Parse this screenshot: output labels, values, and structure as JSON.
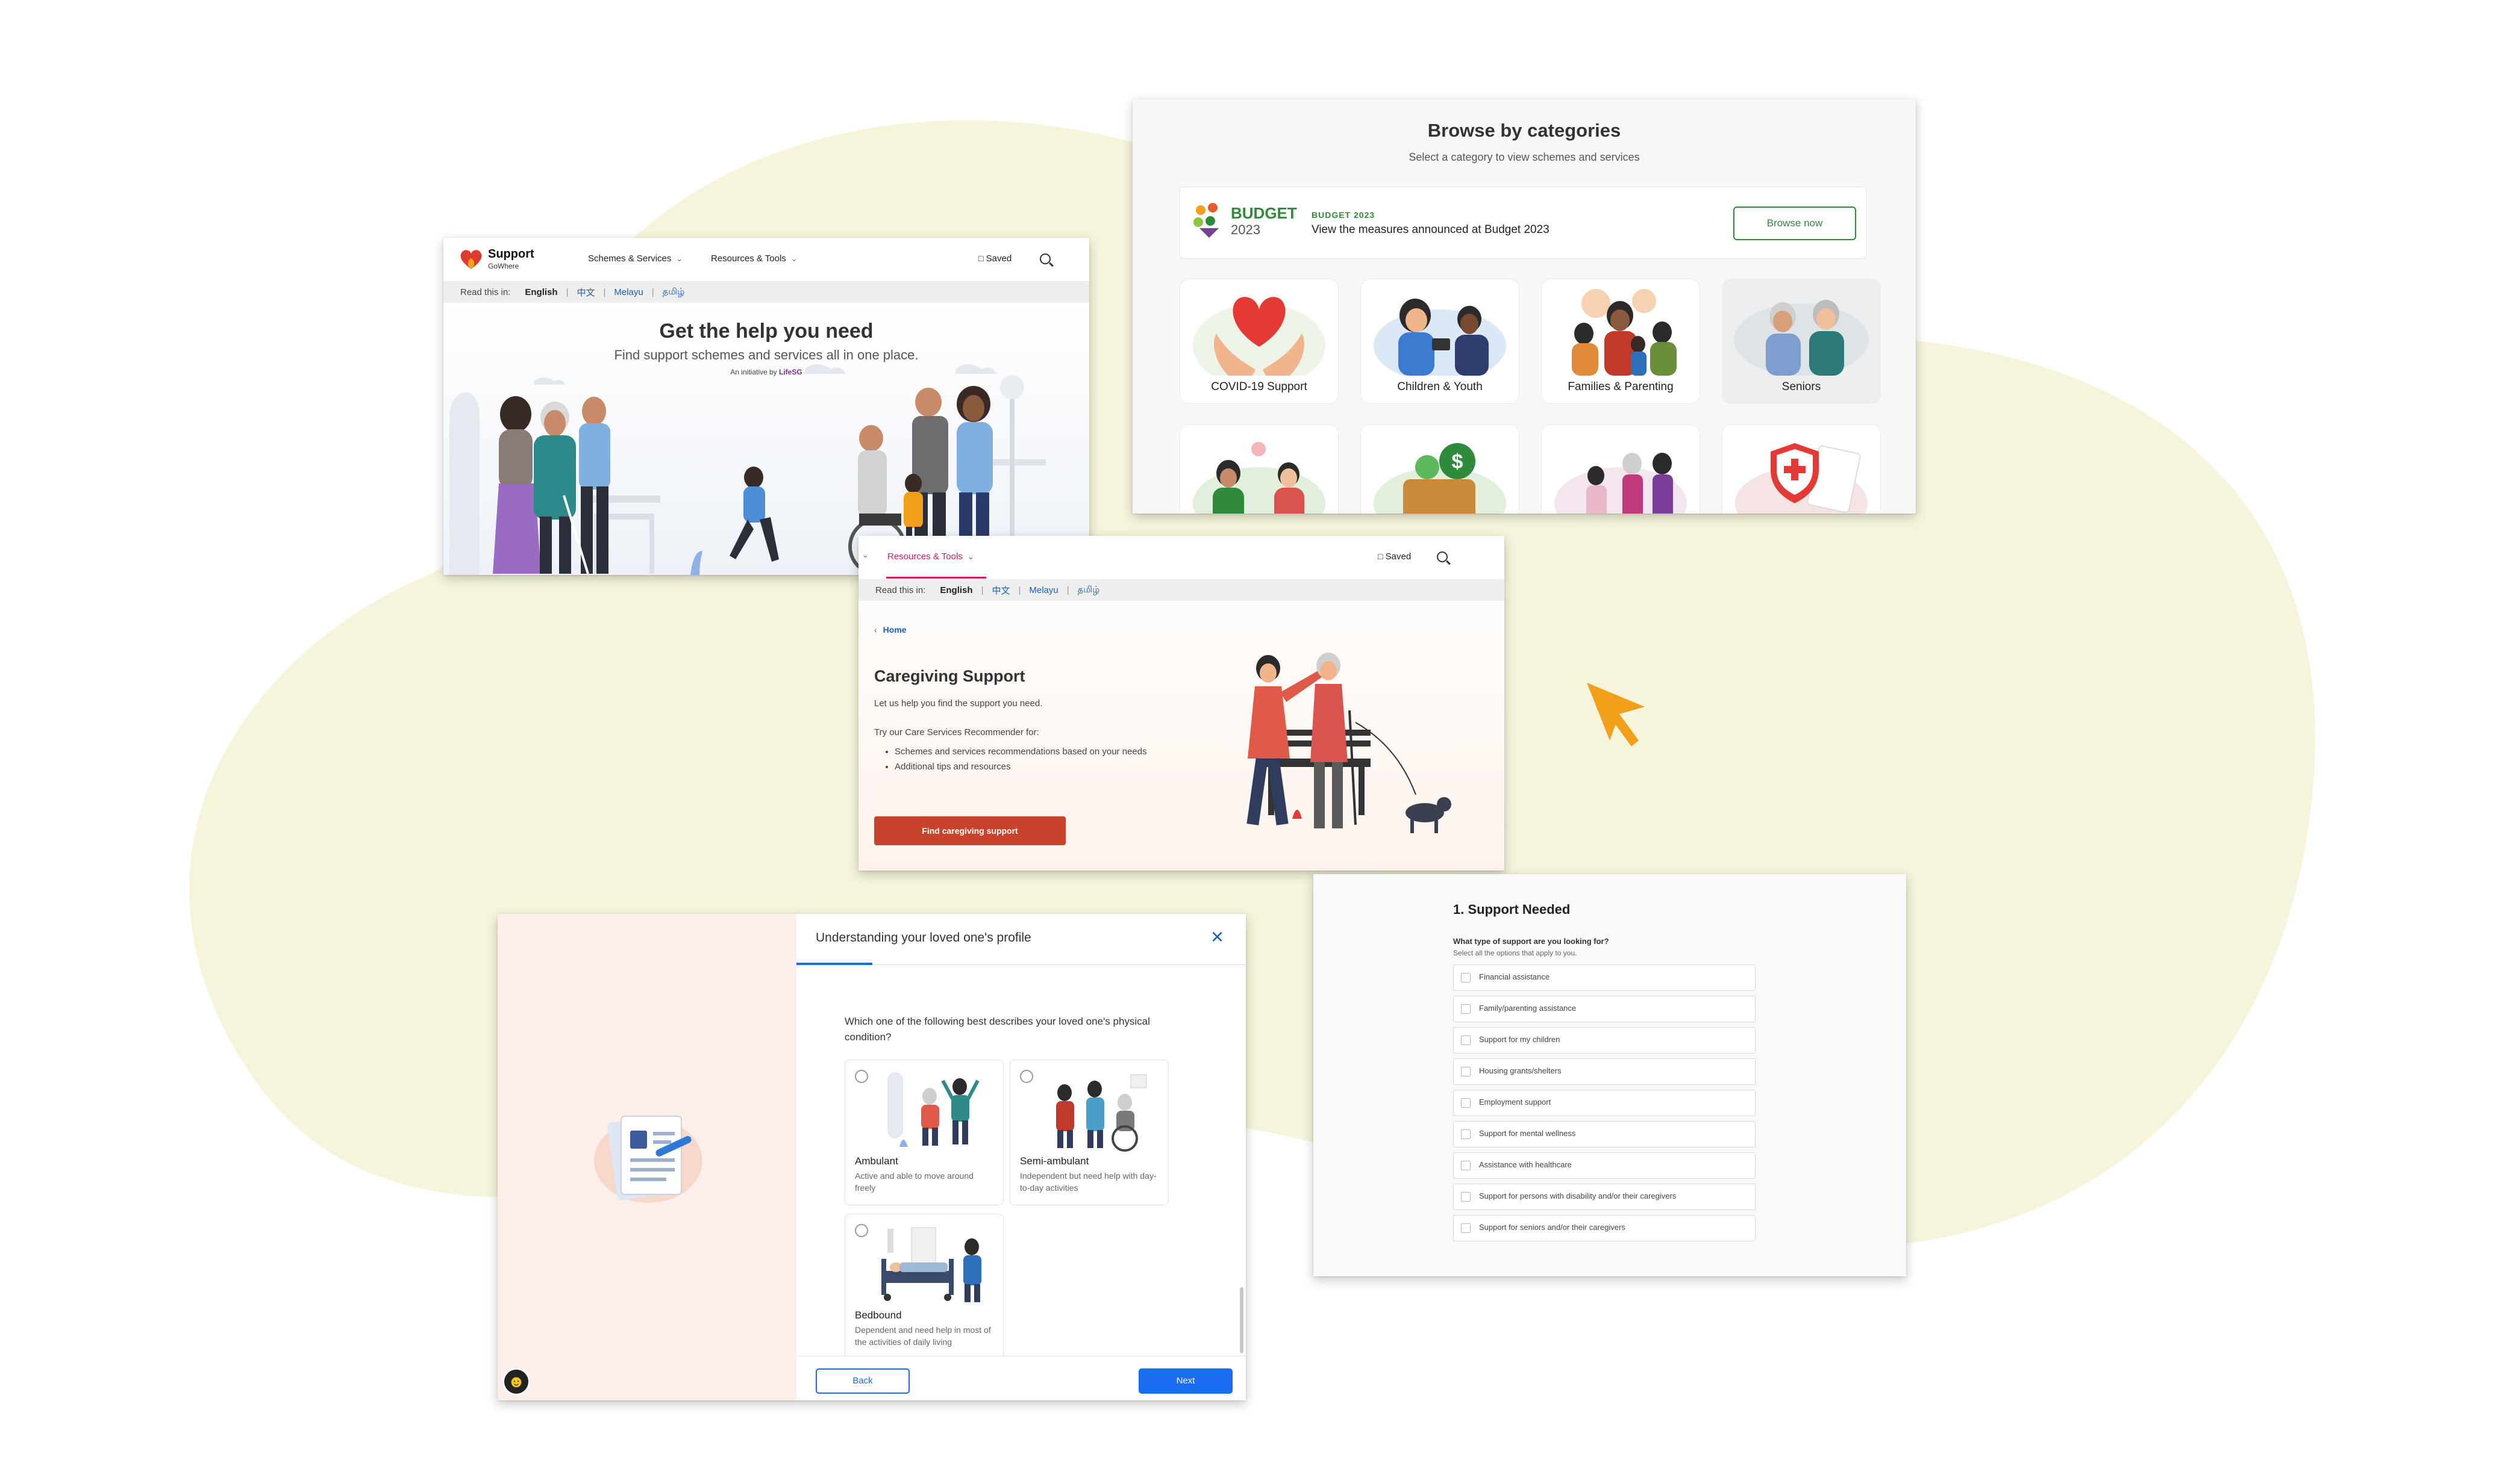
{
  "home": {
    "logo_name": "Support",
    "logo_sub": "GoWhere",
    "nav": [
      "Schemes & Services",
      "Resources & Tools"
    ],
    "saved_label": "Saved",
    "lang_label": "Read this in:",
    "languages": [
      "English",
      "中文",
      "Melayu",
      "தமிழ்"
    ],
    "hero_title": "Get the help you need",
    "hero_subtitle": "Find support schemes and services all in one place.",
    "initiative_prefix": "An initiative by",
    "initiative_brand": "LifeSG"
  },
  "categories": {
    "title": "Browse by categories",
    "subtitle": "Select a category to view schemes and services",
    "budget_logo": "BUDGET",
    "budget_logo_year": "2023",
    "budget_tag": "BUDGET 2023",
    "budget_text": "View the measures announced at Budget 2023",
    "browse_button": "Browse now",
    "cards": [
      "COVID-19 Support",
      "Children & Youth",
      "Families & Parenting",
      "Seniors"
    ]
  },
  "caregiving": {
    "nav_active": "Resources & Tools",
    "saved_label": "Saved",
    "lang_label": "Read this in:",
    "languages": [
      "English",
      "中文",
      "Melayu",
      "தமிழ்"
    ],
    "breadcrumb": "Home",
    "title": "Caregiving Support",
    "intro": "Let us help you find the support you need.",
    "try_text": "Try our Care Services Recommender for:",
    "bullets": [
      "Schemes and services recommendations based on your needs",
      "Additional tips and resources"
    ],
    "cta": "Find caregiving support"
  },
  "profile": {
    "header": "Understanding your loved one's profile",
    "question": "Which one of the following best describes your loved one's physical condition?",
    "options": [
      {
        "title": "Ambulant",
        "desc": "Active and able to move around freely"
      },
      {
        "title": "Semi-ambulant",
        "desc": "Independent but need help with day-to-day activities"
      },
      {
        "title": "Bedbound",
        "desc": "Dependent and need help in most of the activities of daily living"
      }
    ],
    "back": "Back",
    "next": "Next"
  },
  "support": {
    "title": "1. Support Needed",
    "question": "What type of support are you looking for?",
    "hint": "Select all the options that apply to you.",
    "options": [
      "Financial assistance",
      "Family/parenting assistance",
      "Support for my children",
      "Housing grants/shelters",
      "Employment support",
      "Support for mental wellness",
      "Assistance with healthcare",
      "Support for persons with disability and/or their caregivers",
      "Support for seniors and/or their caregivers"
    ]
  },
  "colors": {
    "background_blob": "#f6f5dc",
    "cursor": "#f2a01c",
    "brand_red": "#e03a2f",
    "cta_red": "#c8432b",
    "primary_blue": "#1a6cf0",
    "budget_green": "#2f8a3b"
  }
}
